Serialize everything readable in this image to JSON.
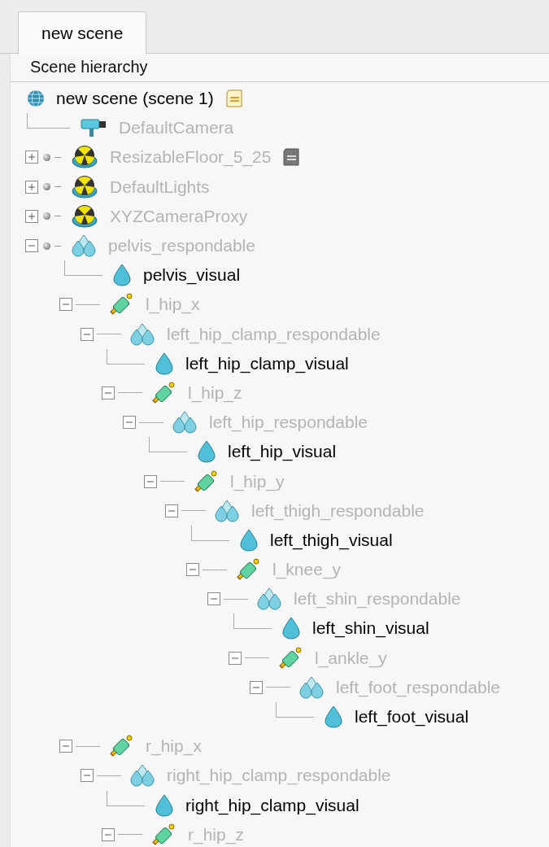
{
  "tabs": [
    {
      "label": "new scene",
      "selected": true
    }
  ],
  "panel": {
    "title": "Scene hierarchy"
  },
  "tree": {
    "label": "new scene (scene 1)",
    "kind": "scene",
    "greyed": false,
    "model": false,
    "script": true,
    "children": [
      {
        "label": "DefaultCamera",
        "kind": "camera",
        "greyed": true,
        "model": false,
        "script": false
      },
      {
        "label": "ResizableFloor_5_25",
        "kind": "dummy",
        "greyed": true,
        "model": true,
        "script": true,
        "expanded": false
      },
      {
        "label": "DefaultLights",
        "kind": "dummy",
        "greyed": true,
        "model": true,
        "script": false,
        "expanded": false
      },
      {
        "label": "XYZCameraProxy",
        "kind": "dummy",
        "greyed": true,
        "model": true,
        "script": false,
        "expanded": false
      },
      {
        "label": "pelvis_respondable",
        "kind": "respondable",
        "greyed": true,
        "model": true,
        "script": false,
        "expanded": true,
        "children": [
          {
            "label": "pelvis_visual",
            "kind": "visual",
            "greyed": false,
            "model": false,
            "script": false
          },
          {
            "label": "l_hip_x",
            "kind": "joint",
            "greyed": true,
            "model": false,
            "script": false,
            "expanded": true,
            "children": [
              {
                "label": "left_hip_clamp_respondable",
                "kind": "respondable",
                "greyed": true,
                "model": false,
                "script": false,
                "expanded": true,
                "children": [
                  {
                    "label": "left_hip_clamp_visual",
                    "kind": "visual",
                    "greyed": false,
                    "model": false,
                    "script": false
                  },
                  {
                    "label": "l_hip_z",
                    "kind": "joint",
                    "greyed": true,
                    "model": false,
                    "script": false,
                    "expanded": true,
                    "children": [
                      {
                        "label": "left_hip_respondable",
                        "kind": "respondable",
                        "greyed": true,
                        "model": false,
                        "script": false,
                        "expanded": true,
                        "children": [
                          {
                            "label": "left_hip_visual",
                            "kind": "visual",
                            "greyed": false,
                            "model": false,
                            "script": false
                          },
                          {
                            "label": "l_hip_y",
                            "kind": "joint",
                            "greyed": true,
                            "model": false,
                            "script": false,
                            "expanded": true,
                            "children": [
                              {
                                "label": "left_thigh_respondable",
                                "kind": "respondable",
                                "greyed": true,
                                "model": false,
                                "script": false,
                                "expanded": true,
                                "children": [
                                  {
                                    "label": "left_thigh_visual",
                                    "kind": "visual",
                                    "greyed": false,
                                    "model": false,
                                    "script": false
                                  },
                                  {
                                    "label": "l_knee_y",
                                    "kind": "joint",
                                    "greyed": true,
                                    "model": false,
                                    "script": false,
                                    "expanded": true,
                                    "children": [
                                      {
                                        "label": "left_shin_respondable",
                                        "kind": "respondable",
                                        "greyed": true,
                                        "model": false,
                                        "script": false,
                                        "expanded": true,
                                        "children": [
                                          {
                                            "label": "left_shin_visual",
                                            "kind": "visual",
                                            "greyed": false,
                                            "model": false,
                                            "script": false
                                          },
                                          {
                                            "label": "l_ankle_y",
                                            "kind": "joint",
                                            "greyed": true,
                                            "model": false,
                                            "script": false,
                                            "expanded": true,
                                            "children": [
                                              {
                                                "label": "left_foot_respondable",
                                                "kind": "respondable",
                                                "greyed": true,
                                                "model": false,
                                                "script": false,
                                                "expanded": true,
                                                "children": [
                                                  {
                                                    "label": "left_foot_visual",
                                                    "kind": "visual",
                                                    "greyed": false,
                                                    "model": false,
                                                    "script": false
                                                  }
                                                ]
                                              }
                                            ]
                                          }
                                        ]
                                      }
                                    ]
                                  }
                                ]
                              }
                            ]
                          }
                        ]
                      }
                    ]
                  }
                ]
              }
            ]
          },
          {
            "label": "r_hip_x",
            "kind": "joint",
            "greyed": true,
            "model": false,
            "script": false,
            "expanded": true,
            "children": [
              {
                "label": "right_hip_clamp_respondable",
                "kind": "respondable",
                "greyed": true,
                "model": false,
                "script": false,
                "expanded": true,
                "children": [
                  {
                    "label": "right_hip_clamp_visual",
                    "kind": "visual",
                    "greyed": false,
                    "model": false,
                    "script": false
                  },
                  {
                    "label": "r_hip_z",
                    "kind": "joint",
                    "greyed": true,
                    "model": false,
                    "script": false,
                    "expanded": true
                  }
                ]
              }
            ]
          }
        ]
      }
    ]
  }
}
